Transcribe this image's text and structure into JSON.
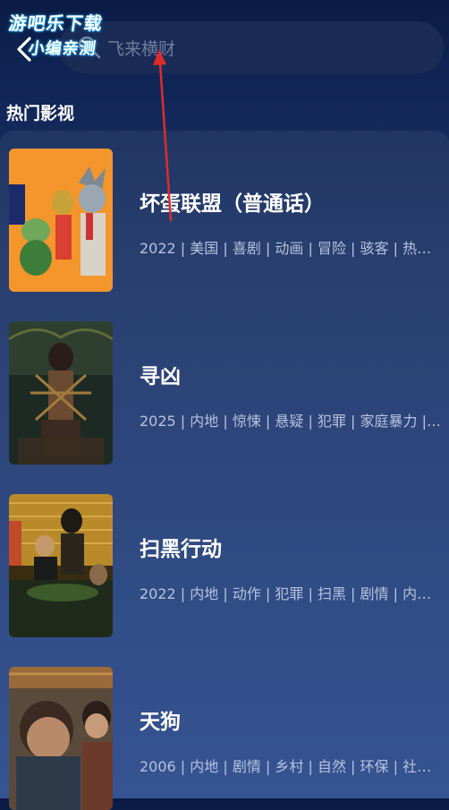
{
  "watermark": {
    "line1": "游吧乐下载",
    "line2": "小编亲测"
  },
  "search": {
    "text": "飞来横财"
  },
  "section": {
    "title": "热门影视"
  },
  "items": [
    {
      "title": "坏蛋联盟（普通话）",
      "meta": "2022 | 美国 | 喜剧 | 动画 | 冒险 | 骇客 | 热…"
    },
    {
      "title": "寻凶",
      "meta": "2025 | 内地 | 惊悚 | 悬疑 | 犯罪 | 家庭暴力 |…"
    },
    {
      "title": "扫黑行动",
      "meta": "2022 | 内地 | 动作 | 犯罪 | 扫黑 | 剧情 | 内…"
    },
    {
      "title": "天狗",
      "meta": "2006 | 内地 | 剧情 | 乡村 | 自然 | 环保 | 社…"
    }
  ],
  "colors": {
    "accent_arrow": "#e02b2b",
    "watermark_glow": "#2ec7ff"
  }
}
